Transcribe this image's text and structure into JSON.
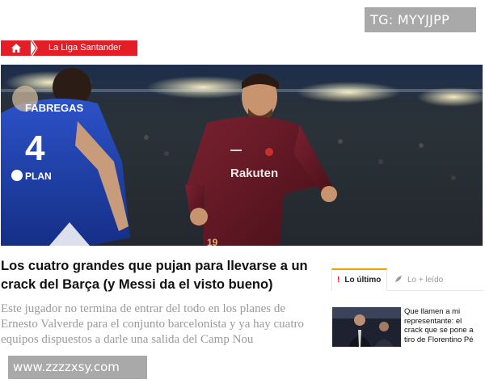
{
  "watermark_top": "TG: MYYJJPP",
  "watermark_bottom": "www.zzzzxsy.com",
  "breadcrumb": {
    "home_icon": "home-icon",
    "section": "La Liga Santander"
  },
  "hero": {
    "player_left_name": "FABREGAS",
    "player_left_number": "4",
    "player_left_sponsor": "PLAN",
    "player_right_sponsor": "Rakuten",
    "player_right_number": "19"
  },
  "article": {
    "title": "Los cuatro grandes que pujan para llevarse a un crack del Barça (y Messi da el visto bueno)",
    "summary": "Este jugador no termina de entrar del todo en los planes de Ernesto Valverde para el conjunto barcelonista y ya hay cuatro equipos dispuestos a darle una salida del Camp Nou"
  },
  "sidebar": {
    "tabs": [
      {
        "icon": "exclamation-icon",
        "label": "Lo último",
        "active": true
      },
      {
        "icon": "rocket-icon",
        "label": "Lo + leído",
        "active": false
      }
    ],
    "items": [
      {
        "title": "Que llamen a mi representante: el crack que se pone a tiro de Florentino Pé"
      }
    ]
  },
  "colors": {
    "accent_red": "#e41e26",
    "tab_underline": "#e9a400",
    "chelsea_blue": "#1f3c9e",
    "barca_maroon": "#6b1a26"
  }
}
